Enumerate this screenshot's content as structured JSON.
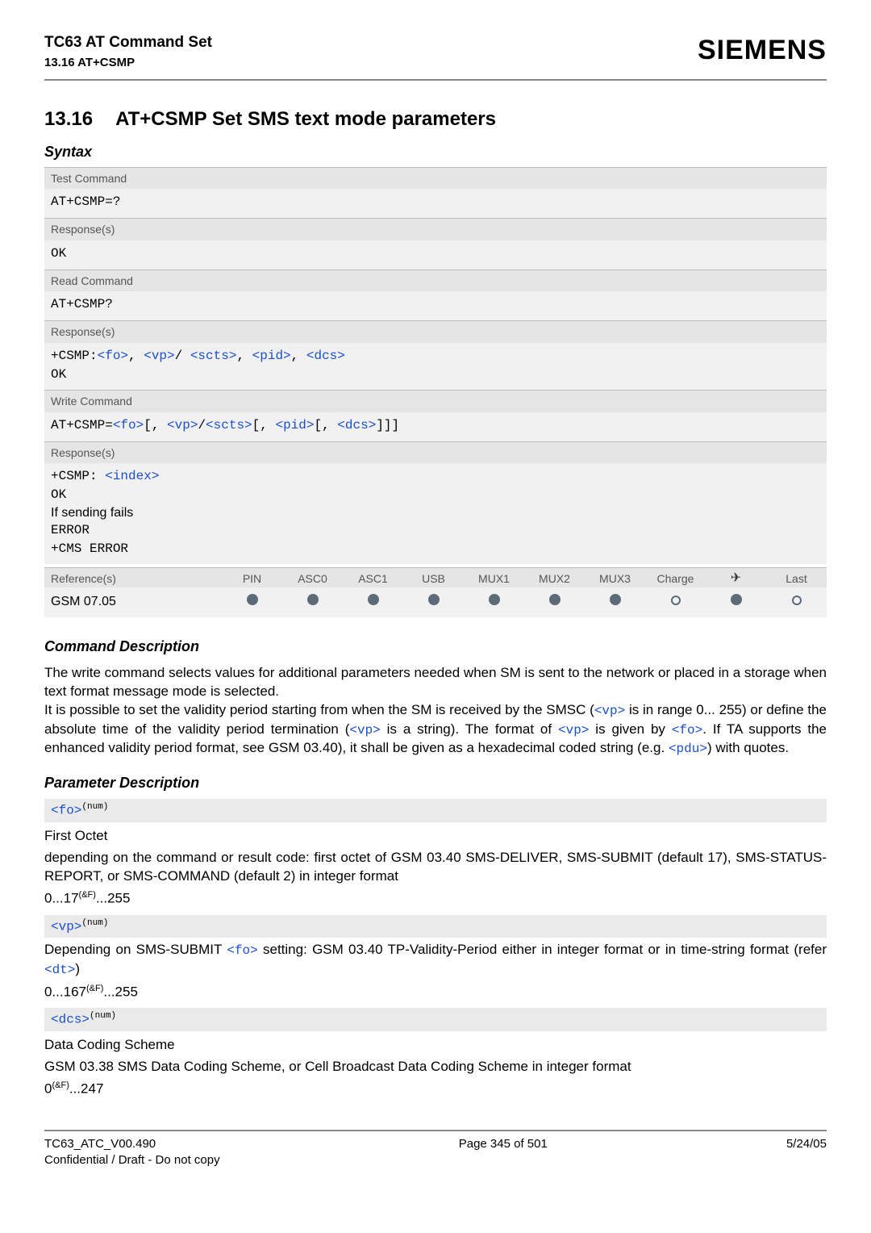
{
  "header": {
    "title": "TC63 AT Command Set",
    "subtitle": "13.16 AT+CSMP",
    "brand": "SIEMENS"
  },
  "section": {
    "number": "13.16",
    "title": "AT+CSMP   Set SMS text mode parameters"
  },
  "syntax": {
    "label": "Syntax",
    "rows": [
      {
        "label": "Test Command",
        "content_html": "<span class='mono'>AT+CSMP=?</span>"
      },
      {
        "label": "Response(s)",
        "content_html": "<span class='mono'>OK</span>"
      },
      {
        "label": "Read Command",
        "content_html": "<span class='mono'>AT+CSMP?</span>"
      },
      {
        "label": "Response(s)",
        "content_html": "<span class='mono'>+CSMP:<span class='lnk'>&lt;fo&gt;</span>, <span class='lnk'>&lt;vp&gt;</span>/ <span class='lnk'>&lt;scts&gt;</span>, <span class='lnk'>&lt;pid&gt;</span>, <span class='lnk'>&lt;dcs&gt;</span><br>OK</span>"
      },
      {
        "label": "Write Command",
        "content_html": "<span class='mono'>AT+CSMP=<span class='lnk'>&lt;fo&gt;</span>[, <span class='lnk'>&lt;vp&gt;</span>/<span class='lnk'>&lt;scts&gt;</span>[, <span class='lnk'>&lt;pid&gt;</span>[, <span class='lnk'>&lt;dcs&gt;</span>]]]</span>"
      },
      {
        "label": "Response(s)",
        "content_html": "<span class='mono'>+CSMP: <span class='lnk'>&lt;index&gt;</span><br>OK</span><br><span class='black'>If sending fails</span><br><span class='mono'>ERROR<br>+CMS ERROR</span>"
      }
    ],
    "refs_label": "Reference(s)",
    "matrix_headers": [
      "PIN",
      "ASC0",
      "ASC1",
      "USB",
      "MUX1",
      "MUX2",
      "MUX3",
      "Charge",
      "✈",
      "Last"
    ],
    "ref_name": "GSM 07.05",
    "matrix_values": [
      "filled",
      "filled",
      "filled",
      "filled",
      "filled",
      "filled",
      "filled",
      "open",
      "filled",
      "open"
    ]
  },
  "cmd_desc": {
    "heading": "Command Description",
    "para_html": "The write command selects values for additional parameters needed when SM is sent to the network or placed in a storage when text format message mode is selected.<br>It is possible to set the validity period starting from when the SM is received by the SMSC (<span class='mono lnk'>&lt;vp&gt;</span> is in range 0... 255) or define the absolute time of the validity period termination (<span class='mono lnk'>&lt;vp&gt;</span> is a string). The format of <span class='mono lnk'>&lt;vp&gt;</span> is given by <span class='mono lnk'>&lt;fo&gt;</span>. If TA supports the enhanced validity period format, see GSM 03.40), it shall be given as a hexadecimal coded string (e.g. <span class='mono lnk'>&lt;pdu&gt;</span>) with quotes."
  },
  "param_desc": {
    "heading": "Parameter Description",
    "params": [
      {
        "tag_html": "<span class='lnk'>&lt;fo&gt;</span><span class='sup'>(num)</span>",
        "title": "First Octet",
        "body_html": "depending on the command or result code: first octet of GSM 03.40 SMS-DELIVER, SMS-SUBMIT (default 17), SMS-STATUS-REPORT, or SMS-COMMAND (default 2) in integer format",
        "range_html": "0...17<span class='sup'>(&amp;F)</span>...255"
      },
      {
        "tag_html": "<span class='lnk'>&lt;vp&gt;</span><span class='sup'>(num)</span>",
        "title": "",
        "body_html": "Depending on SMS-SUBMIT <span class='mono lnk'>&lt;fo&gt;</span> setting: GSM 03.40 TP-Validity-Period either in integer format or in time-string format (refer <span class='mono lnk'>&lt;dt&gt;</span>)",
        "range_html": "0...167<span class='sup'>(&amp;F)</span>...255"
      },
      {
        "tag_html": "<span class='lnk'>&lt;dcs&gt;</span><span class='sup'>(num)</span>",
        "title": "Data Coding Scheme",
        "body_html": "GSM 03.38 SMS Data Coding Scheme, or Cell Broadcast Data Coding Scheme in integer format",
        "range_html": "0<span class='sup'>(&amp;F)</span>...247"
      }
    ]
  },
  "footer": {
    "left1": "TC63_ATC_V00.490",
    "left2": "Confidential / Draft - Do not copy",
    "center": "Page 345 of 501",
    "right": "5/24/05"
  }
}
